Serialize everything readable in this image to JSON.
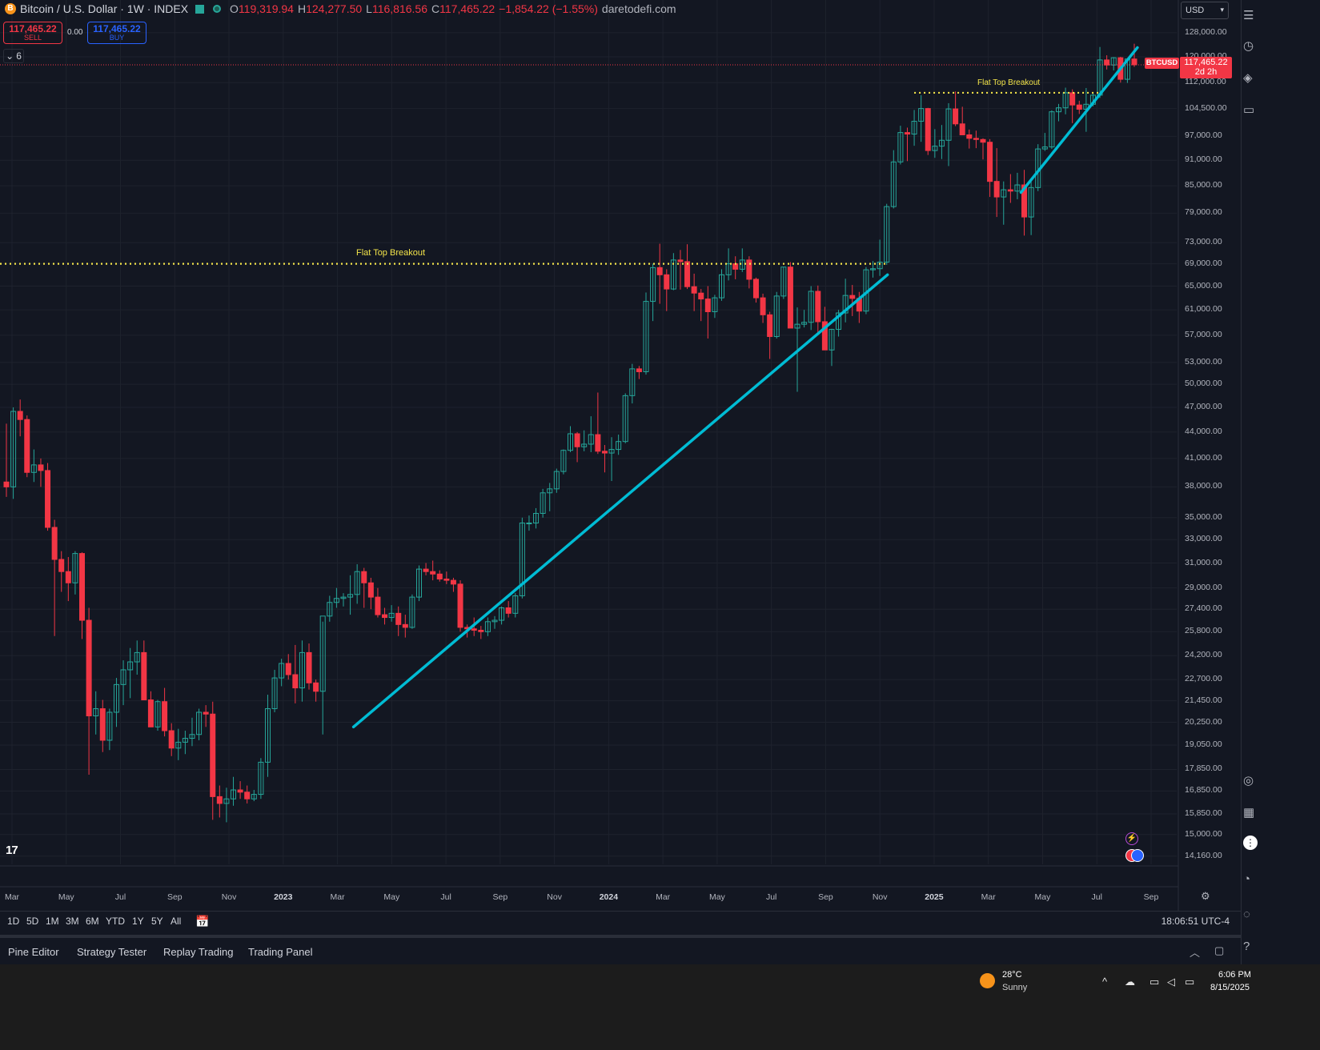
{
  "legend": {
    "symbol_icon": "B",
    "title": "Bitcoin / U.S. Dollar · 1W · INDEX",
    "o_label": "O",
    "o_value": "119,319.94",
    "h_label": "H",
    "h_value": "124,277.50",
    "l_label": "L",
    "l_value": "116,816.56",
    "c_label": "C",
    "c_value": "117,465.22",
    "change": "−1,854.22 (−1.55%)",
    "watermark": "daretodefi.com"
  },
  "trade": {
    "sell_price": "117,465.22",
    "sell_label": "SELL",
    "spread": "0.00",
    "buy_price": "117,465.22",
    "buy_label": "BUY"
  },
  "indicators_collapse": "6",
  "currency": "USD",
  "last_price": {
    "symbol": "BTCUSD",
    "price": "117,465.22",
    "countdown": "2d 2h"
  },
  "price_axis": [
    "128,000.00",
    "120,000.00",
    "112,000.00",
    "104,500.00",
    "97,000.00",
    "91,000.00",
    "85,000.00",
    "79,000.00",
    "73,000.00",
    "69,000.00",
    "65,000.00",
    "61,000.00",
    "57,000.00",
    "53,000.00",
    "50,000.00",
    "47,000.00",
    "44,000.00",
    "41,000.00",
    "38,000.00",
    "35,000.00",
    "33,000.00",
    "31,000.00",
    "29,000.00",
    "27,400.00",
    "25,800.00",
    "24,200.00",
    "22,700.00",
    "21,450.00",
    "20,250.00",
    "19,050.00",
    "17,850.00",
    "16,850.00",
    "15,850.00",
    "15,000.00",
    "14,160.00"
  ],
  "time_axis": [
    {
      "label": "Mar",
      "bold": false
    },
    {
      "label": "May",
      "bold": false
    },
    {
      "label": "Jul",
      "bold": false
    },
    {
      "label": "Sep",
      "bold": false
    },
    {
      "label": "Nov",
      "bold": false
    },
    {
      "label": "2023",
      "bold": true
    },
    {
      "label": "Mar",
      "bold": false
    },
    {
      "label": "May",
      "bold": false
    },
    {
      "label": "Jul",
      "bold": false
    },
    {
      "label": "Sep",
      "bold": false
    },
    {
      "label": "Nov",
      "bold": false
    },
    {
      "label": "2024",
      "bold": true
    },
    {
      "label": "Mar",
      "bold": false
    },
    {
      "label": "May",
      "bold": false
    },
    {
      "label": "Jul",
      "bold": false
    },
    {
      "label": "Sep",
      "bold": false
    },
    {
      "label": "Nov",
      "bold": false
    },
    {
      "label": "2025",
      "bold": true
    },
    {
      "label": "Mar",
      "bold": false
    },
    {
      "label": "May",
      "bold": false
    },
    {
      "label": "Jul",
      "bold": false
    },
    {
      "label": "Sep",
      "bold": false
    }
  ],
  "annotations": {
    "flat_top_1": "Flat Top Breakout",
    "flat_top_2": "Flat Top Breakout"
  },
  "colors": {
    "up": "#26a69a",
    "down": "#f23645",
    "trendline": "#00bcd4",
    "resistance": "#f3e44a",
    "background": "#131722"
  },
  "range_buttons": [
    "1D",
    "5D",
    "1M",
    "3M",
    "6M",
    "YTD",
    "1Y",
    "5Y",
    "All"
  ],
  "clock": "18:06:51 UTC-4",
  "panel_tabs": [
    "Pine Editor",
    "Strategy Tester",
    "Replay Trading",
    "Trading Panel"
  ],
  "taskbar": {
    "temp": "28°C",
    "weather": "Sunny",
    "time": "6:06 PM",
    "date": "8/15/2025"
  },
  "chart_data": {
    "type": "candlestick",
    "symbol": "BTCUSD",
    "interval": "1W",
    "scale": "log",
    "ylim": [
      14000,
      131000
    ],
    "x_range": [
      "2022-02",
      "2025-09"
    ],
    "candles": [
      [
        38500,
        45000,
        37000,
        38000
      ],
      [
        38000,
        47000,
        36800,
        46500
      ],
      [
        46500,
        48000,
        43500,
        45500
      ],
      [
        45500,
        46000,
        39000,
        39500
      ],
      [
        39500,
        42000,
        38500,
        40300
      ],
      [
        40300,
        41000,
        38000,
        39700
      ],
      [
        39700,
        40500,
        33800,
        34100
      ],
      [
        34100,
        34800,
        25500,
        31300
      ],
      [
        31300,
        32000,
        28700,
        30300
      ],
      [
        30300,
        31500,
        28000,
        29400
      ],
      [
        29400,
        32000,
        28500,
        31800
      ],
      [
        31800,
        31900,
        25300,
        26600
      ],
      [
        26600,
        27500,
        17600,
        20600
      ],
      [
        20600,
        22000,
        19600,
        21000
      ],
      [
        21000,
        21500,
        18700,
        19300
      ],
      [
        19300,
        21000,
        18800,
        20800
      ],
      [
        20800,
        22800,
        20000,
        22400
      ],
      [
        22400,
        23900,
        21200,
        23300
      ],
      [
        23300,
        24700,
        21600,
        23800
      ],
      [
        23800,
        25200,
        23000,
        24400
      ],
      [
        24400,
        25200,
        21800,
        21500
      ],
      [
        21500,
        22000,
        20600,
        20000
      ],
      [
        20000,
        21500,
        19800,
        21400
      ],
      [
        21400,
        22200,
        19500,
        19800
      ],
      [
        19800,
        20200,
        18500,
        18900
      ],
      [
        18900,
        19900,
        18300,
        19200
      ],
      [
        19200,
        19800,
        18600,
        19400
      ],
      [
        19400,
        20500,
        19000,
        19600
      ],
      [
        19600,
        21000,
        19300,
        20800
      ],
      [
        20800,
        21200,
        20000,
        20700
      ],
      [
        20700,
        21400,
        15600,
        16600
      ],
      [
        16600,
        17100,
        15700,
        16300
      ],
      [
        16300,
        17000,
        15500,
        16500
      ],
      [
        16500,
        17500,
        16200,
        16900
      ],
      [
        16900,
        17300,
        16500,
        16800
      ],
      [
        16800,
        17100,
        16300,
        16500
      ],
      [
        16500,
        16900,
        16400,
        16700
      ],
      [
        16700,
        18400,
        16500,
        18200
      ],
      [
        18200,
        21800,
        17500,
        21000
      ],
      [
        21000,
        23300,
        20800,
        22800
      ],
      [
        22800,
        24000,
        22300,
        23700
      ],
      [
        23700,
        24300,
        22700,
        23000
      ],
      [
        23000,
        24900,
        21300,
        22200
      ],
      [
        22200,
        25200,
        21400,
        24400
      ],
      [
        24400,
        25000,
        22100,
        22500
      ],
      [
        22500,
        22700,
        21400,
        22000
      ],
      [
        22000,
        26500,
        19600,
        26900
      ],
      [
        26900,
        28400,
        26500,
        27900
      ],
      [
        27900,
        29000,
        27500,
        28200
      ],
      [
        28200,
        28600,
        27600,
        28300
      ],
      [
        28300,
        30000,
        27000,
        28500
      ],
      [
        28500,
        30900,
        27800,
        30300
      ],
      [
        30300,
        30600,
        27500,
        29400
      ],
      [
        29400,
        29800,
        27400,
        28300
      ],
      [
        28300,
        29000,
        26800,
        27000
      ],
      [
        27000,
        27500,
        26300,
        26800
      ],
      [
        26800,
        27700,
        26500,
        27100
      ],
      [
        27100,
        27600,
        25500,
        26300
      ],
      [
        26300,
        27000,
        25400,
        26100
      ],
      [
        26100,
        28500,
        26000,
        28300
      ],
      [
        28300,
        30800,
        28000,
        30500
      ],
      [
        30500,
        31000,
        30000,
        30300
      ],
      [
        30300,
        31200,
        29600,
        30100
      ],
      [
        30100,
        30400,
        29500,
        29700
      ],
      [
        29700,
        30300,
        29300,
        29600
      ],
      [
        29600,
        29800,
        28700,
        29300
      ],
      [
        29300,
        29600,
        25800,
        26100
      ],
      [
        26100,
        26300,
        25400,
        26000
      ],
      [
        26000,
        26800,
        25500,
        25900
      ],
      [
        25900,
        26200,
        25300,
        25800
      ],
      [
        25800,
        26800,
        25500,
        26500
      ],
      [
        26500,
        26900,
        26000,
        26600
      ],
      [
        26600,
        27600,
        26300,
        27500
      ],
      [
        27500,
        28000,
        26800,
        27100
      ],
      [
        27100,
        28600,
        26800,
        28400
      ],
      [
        28400,
        35000,
        28200,
        34500
      ],
      [
        34500,
        35200,
        33800,
        34500
      ],
      [
        34500,
        35900,
        34000,
        35400
      ],
      [
        35400,
        37800,
        35000,
        37400
      ],
      [
        37400,
        38400,
        35600,
        37800
      ],
      [
        37800,
        39900,
        37400,
        39600
      ],
      [
        39600,
        42000,
        39300,
        41900
      ],
      [
        41900,
        44700,
        41700,
        43800
      ],
      [
        43800,
        44000,
        40600,
        42300
      ],
      [
        42300,
        44200,
        41800,
        42600
      ],
      [
        42600,
        45900,
        41700,
        43700
      ],
      [
        43700,
        48900,
        41500,
        41800
      ],
      [
        41800,
        42500,
        39500,
        41600
      ],
      [
        41600,
        43400,
        38600,
        42000
      ],
      [
        42000,
        43700,
        41400,
        42900
      ],
      [
        42900,
        48800,
        42700,
        48500
      ],
      [
        48500,
        52800,
        47500,
        52100
      ],
      [
        52100,
        52500,
        50700,
        51700
      ],
      [
        51700,
        63900,
        51300,
        62400
      ],
      [
        62400,
        69000,
        59200,
        68300
      ],
      [
        68300,
        72800,
        62000,
        67000
      ],
      [
        67000,
        68000,
        60800,
        64500
      ],
      [
        64500,
        71000,
        64300,
        69700
      ],
      [
        69700,
        71600,
        64400,
        69400
      ],
      [
        69400,
        72700,
        64500,
        64900
      ],
      [
        64900,
        67200,
        60800,
        63800
      ],
      [
        63800,
        64500,
        59200,
        62800
      ],
      [
        62800,
        65000,
        56500,
        60700
      ],
      [
        60700,
        63500,
        59700,
        63000
      ],
      [
        63000,
        68000,
        62500,
        67000
      ],
      [
        67000,
        71900,
        66000,
        69000
      ],
      [
        69000,
        70400,
        66200,
        68000
      ],
      [
        68000,
        71900,
        67500,
        69700
      ],
      [
        69700,
        70400,
        64600,
        66200
      ],
      [
        66200,
        66500,
        62200,
        63000
      ],
      [
        63000,
        63700,
        58900,
        60200
      ],
      [
        60200,
        60700,
        53500,
        56800
      ],
      [
        56800,
        64000,
        56500,
        63300
      ],
      [
        63300,
        68400,
        62800,
        68400
      ],
      [
        68400,
        69300,
        64700,
        58100
      ],
      [
        58100,
        61400,
        49000,
        58700
      ],
      [
        58700,
        61000,
        58200,
        59000
      ],
      [
        59000,
        65000,
        57800,
        64100
      ],
      [
        64100,
        65100,
        57400,
        59100
      ],
      [
        59100,
        61500,
        56500,
        54800
      ],
      [
        54800,
        58000,
        52500,
        57900
      ],
      [
        57900,
        61000,
        56800,
        60500
      ],
      [
        60500,
        66300,
        59000,
        63400
      ],
      [
        63400,
        65200,
        60000,
        62900
      ],
      [
        62900,
        64000,
        58900,
        60800
      ],
      [
        60800,
        68400,
        60300,
        67900
      ],
      [
        67900,
        69500,
        66500,
        68100
      ],
      [
        68100,
        73600,
        66800,
        69300
      ],
      [
        69300,
        81000,
        68800,
        80400
      ],
      [
        80400,
        93500,
        80000,
        90600
      ],
      [
        90600,
        99800,
        90000,
        98000
      ],
      [
        98000,
        99300,
        90800,
        97600
      ],
      [
        97600,
        104100,
        94600,
        101000
      ],
      [
        101000,
        108300,
        95600,
        104500
      ],
      [
        104500,
        104700,
        92300,
        93400
      ],
      [
        93400,
        98900,
        91600,
        94500
      ],
      [
        94500,
        100000,
        91300,
        96000
      ],
      [
        96000,
        106000,
        89600,
        104400
      ],
      [
        104400,
        109400,
        99700,
        100300
      ],
      [
        100300,
        105000,
        97500,
        97400
      ],
      [
        97400,
        98800,
        93900,
        96500
      ],
      [
        96500,
        98500,
        94000,
        96200
      ],
      [
        96200,
        96500,
        91200,
        95500
      ],
      [
        95500,
        96300,
        82500,
        86000
      ],
      [
        86000,
        94000,
        78200,
        82500
      ],
      [
        82500,
        86000,
        76600,
        84100
      ],
      [
        84100,
        87700,
        81200,
        83800
      ],
      [
        83800,
        88000,
        82000,
        85200
      ],
      [
        85200,
        88700,
        74400,
        78200
      ],
      [
        78200,
        86100,
        74500,
        84600
      ],
      [
        84600,
        95000,
        83800,
        93800
      ],
      [
        93800,
        97900,
        93300,
        94300
      ],
      [
        94300,
        104000,
        93800,
        103600
      ],
      [
        103600,
        105800,
        101000,
        104700
      ],
      [
        104700,
        110500,
        102900,
        109000
      ],
      [
        109000,
        110000,
        100500,
        105500
      ],
      [
        105500,
        106700,
        103000,
        104300
      ],
      [
        104300,
        110400,
        98200,
        105700
      ],
      [
        105700,
        109000,
        105100,
        108300
      ],
      [
        108300,
        123200,
        107500,
        119000
      ],
      [
        119000,
        120500,
        116000,
        117400
      ],
      [
        117400,
        119900,
        115700,
        119700
      ],
      [
        119700,
        120000,
        112000,
        113000
      ],
      [
        113000,
        119600,
        111900,
        119300
      ],
      [
        119300,
        124277.5,
        116816.56,
        117465.22
      ]
    ],
    "last_price": 117465.22,
    "resistance_lines": [
      {
        "label": "Flat Top Breakout",
        "price": 69000,
        "from": "2022-02",
        "to": "2024-11"
      },
      {
        "label": "Flat Top Breakout",
        "price": 109000,
        "from": "2024-12",
        "to": "2025-07"
      }
    ],
    "trendlines": [
      {
        "from_price": 20000,
        "from": "2023-03",
        "to_price": 67000,
        "to": "2024-11"
      },
      {
        "from_price": 83500,
        "from": "2025-04",
        "to_price": 123000,
        "to": "2025-08"
      }
    ]
  }
}
